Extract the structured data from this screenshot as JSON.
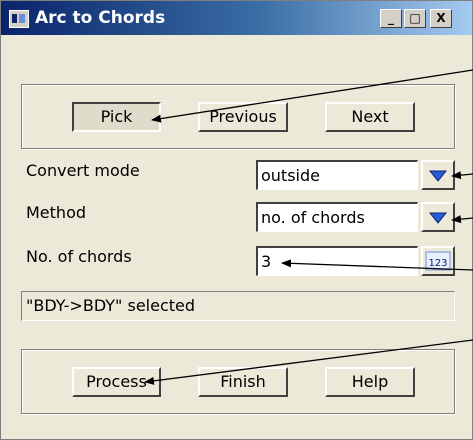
{
  "window": {
    "title": "Arc to Chords"
  },
  "titlebar_buttons": {
    "minimize": "_",
    "maximize": "□",
    "close": "X"
  },
  "top_buttons": {
    "pick": "Pick",
    "previous": "Previous",
    "next": "Next"
  },
  "form": {
    "convert_mode": {
      "label": "Convert mode",
      "value": "outside"
    },
    "method": {
      "label": "Method",
      "value": "no. of chords"
    },
    "chords": {
      "label": "No. of chords",
      "value": "3",
      "calc_icon_text": "123"
    }
  },
  "status": {
    "text": "\"BDY->BDY\" selected"
  },
  "bottom_buttons": {
    "process": "Process",
    "finish": "Finish",
    "help": "Help"
  },
  "colors": {
    "titlebar_start": "#0a246a",
    "titlebar_end": "#a6caf0",
    "dialog_bg": "#ece9d8",
    "dropdown_arrow": "#2a5bd7"
  }
}
